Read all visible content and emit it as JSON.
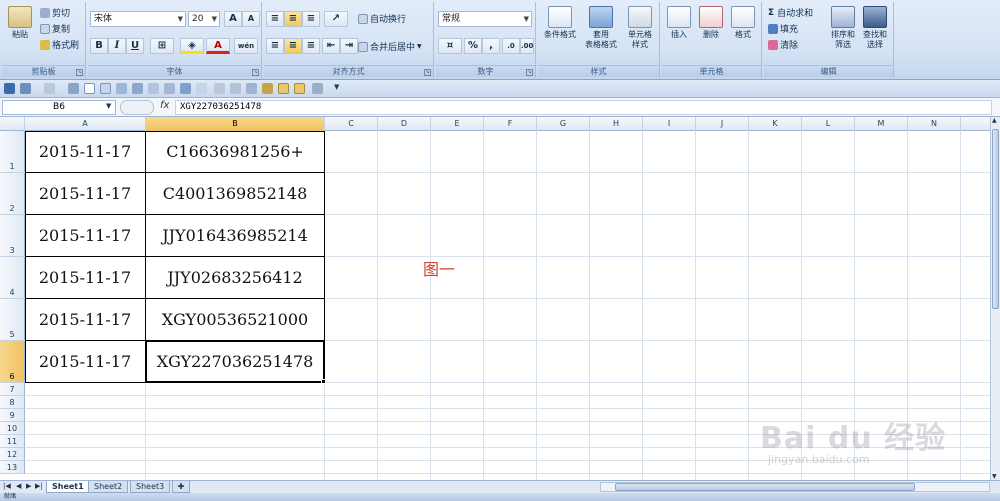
{
  "ribbon": {
    "clipboard": {
      "paste": "粘贴",
      "cut": "剪切",
      "copy": "复制",
      "format_painter": "格式刷",
      "group_label": "剪贴板"
    },
    "font": {
      "name": "宋体",
      "size": "20",
      "bold": "B",
      "italic": "I",
      "underline": "U",
      "grow": "A",
      "shrink": "A",
      "group_label": "字体",
      "phonetic": "wén"
    },
    "alignment": {
      "wrap_text": "自动换行",
      "merge_center": "合并后居中",
      "group_label": "对齐方式"
    },
    "number": {
      "format": "常规",
      "percent": "%",
      "comma": ",",
      "group_label": "数字"
    },
    "styles": {
      "conditional": "条件格式",
      "table_format": "套用\n表格格式",
      "cell_styles": "单元格\n样式",
      "group_label": "样式"
    },
    "cells": {
      "insert": "插入",
      "delete": "删除",
      "format": "格式",
      "group_label": "单元格"
    },
    "editing": {
      "autosum": "自动求和",
      "fill": "填充",
      "clear": "清除",
      "sort_filter": "排序和\n筛选",
      "find_select": "查找和\n选择",
      "group_label": "编辑"
    }
  },
  "formula_bar": {
    "name_box": "B6",
    "fx": "fx",
    "content": "XGY227036251478"
  },
  "sheet": {
    "columns": [
      "A",
      "B",
      "C",
      "D",
      "E",
      "F",
      "G",
      "H",
      "I",
      "J",
      "K",
      "L",
      "M",
      "N"
    ],
    "selected_column": "B",
    "selected_row": "6",
    "rows": [
      {
        "num": "1",
        "a": "2015-11-17",
        "b": "C16636981256+"
      },
      {
        "num": "2",
        "a": "2015-11-17",
        "b": "C4001369852148"
      },
      {
        "num": "3",
        "a": "2015-11-17",
        "b": "JJY016436985214"
      },
      {
        "num": "4",
        "a": "2015-11-17",
        "b": "JJY02683256412"
      },
      {
        "num": "5",
        "a": "2015-11-17",
        "b": "XGY00536521000"
      },
      {
        "num": "6",
        "a": "2015-11-17",
        "b": "XGY227036251478"
      }
    ],
    "small_rows": [
      "7",
      "8",
      "9",
      "10",
      "11",
      "12",
      "13"
    ],
    "annotation": "图一"
  },
  "tabs": {
    "sheets": [
      "Sheet1",
      "Sheet2",
      "Sheet3"
    ],
    "active": "Sheet1"
  },
  "status": {
    "ready": "就绪"
  },
  "watermark": {
    "brand": "Bai du 经验",
    "url": "jingyan.baidu.com"
  },
  "colors": {
    "selection_header": "#f1c15f",
    "annotation": "#d6402e",
    "ribbon_bg": "#d6e3f5"
  }
}
